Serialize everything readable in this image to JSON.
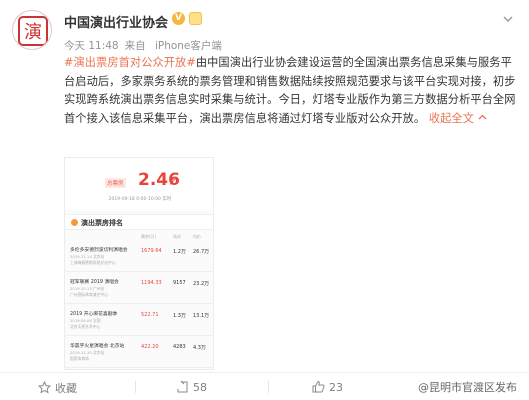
{
  "post": {
    "author": "中国演出行业协会",
    "avatar_text": "演",
    "meta": {
      "time": "今天 11:48",
      "source_prefix": "来自",
      "source": "iPhone客户端"
    },
    "topic": "#演出票房首对公众开放#",
    "body": "由中国演出行业协会建设运营的全国演出票务信息采集与服务平台启动后，多家票务系统的票务管理和销售数据陆续按照规范要求与该平台实现对接，初步实现跨系统演出票务信息实时采集与统计。今日，灯塔专业版作为第三方数据分析平台全网首个接入该信息采集平台，演出票房信息将通过灯塔专业版对公众开放。",
    "expand_label": "收起全文",
    "expand_icon": "chevron-up-icon"
  },
  "image": {
    "stat_label": "总票房",
    "stat_value": "2.46",
    "stat_unit": "亿",
    "stat_sub": "2019-09-18 0:00-10:00 实时",
    "rank_title": "演出票房排名",
    "columns": [
      "票房(万)",
      "场次",
      "均价"
    ],
    "rows": [
      {
        "name": "多伦多安德烈波切利演唱会",
        "sub1": "2019.11.14 北京站",
        "sub2": "上海梅赛德斯奔驰文化中心",
        "v1": "1679.64",
        "v2": "1.2万",
        "v3": "26.7万"
      },
      {
        "name": "冠军联赛 2019 演唱会",
        "sub1": "2019.10.13 广州站",
        "sub2": "广州国际体育演艺中心",
        "v1": "1194.33",
        "v2": "9157",
        "v3": "23.2万"
      },
      {
        "name": "2019 开心麻花喜剧季",
        "sub1": "2019.09.06 全国",
        "sub2": "北京天桥艺术中心",
        "v1": "522.71",
        "v2": "1.3万",
        "v3": "13.1万"
      },
      {
        "name": "华晨宇火星演唱会 北京站",
        "sub1": "2019.11.30 北京站",
        "sub2": "国家体育场",
        "v1": "422.20",
        "v2": "4283",
        "v3": "4.3万"
      }
    ]
  },
  "footer": {
    "favorite_label": "收藏",
    "repost_count": "58",
    "like_count": "23",
    "watermark": "@昆明市官渡区发布"
  },
  "colors": {
    "accent": "#eb7350",
    "verify": "#f6b53d",
    "stat_red": "#e8433c"
  }
}
